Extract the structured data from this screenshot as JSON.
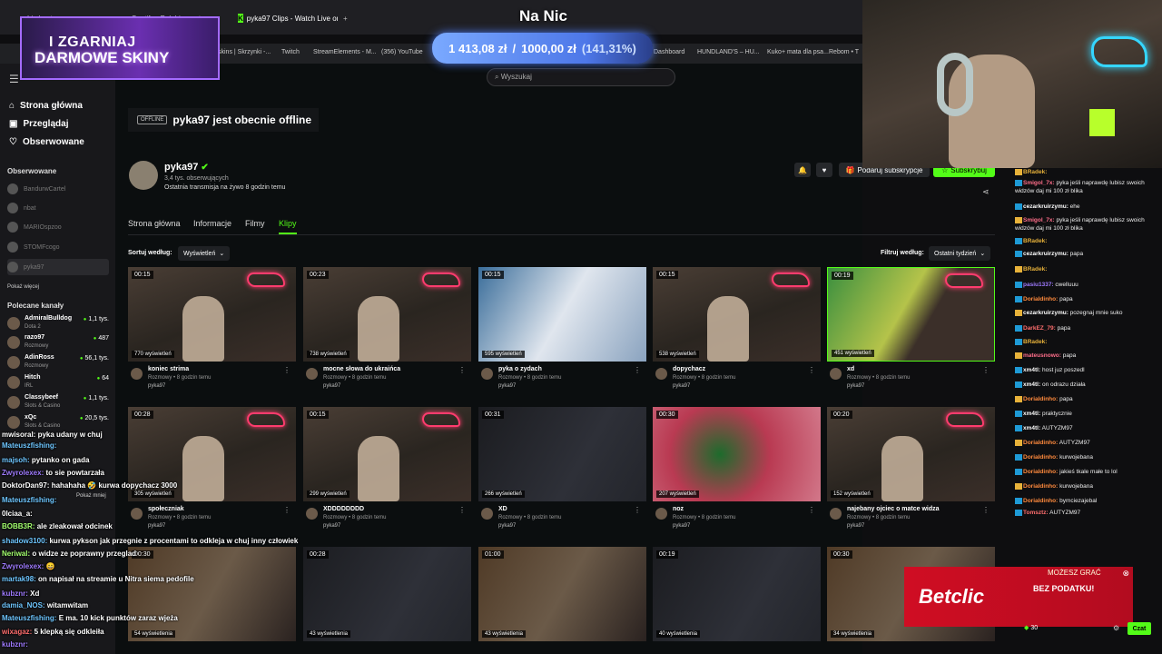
{
  "browser": {
    "tabs": [
      {
        "label": "Lis hosta"
      },
      {
        "label": "Spotify - Polubione utwory"
      },
      {
        "label": "pyka97 Clips - Watch Live on Kick"
      }
    ],
    "new_tab": "+",
    "bookmarks": [
      "skins | Skrzynki -...",
      "Twitch",
      "StreamElements - M...",
      "(356) YouTube",
      "Dashboard",
      "HUNDLAND'S – HU...",
      "Kuko+ mata dla psa...",
      "Rebom • T"
    ]
  },
  "overlay": {
    "promo_line1": "I ZGARNIAJ",
    "promo_line2": "DARMOWE SKINY",
    "title": "Na Nic",
    "goal_current": "1 413,08 zł",
    "goal_sep": "/",
    "goal_target": "1000,00 zł",
    "goal_pct": "(141,31%)"
  },
  "search": {
    "placeholder": "Wyszukaj"
  },
  "sidebar": {
    "nav": [
      {
        "label": "Strona główna",
        "icon": "home-icon"
      },
      {
        "label": "Przeglądaj",
        "icon": "browse-icon"
      },
      {
        "label": "Obserwowane",
        "icon": "heart-icon"
      }
    ],
    "followed_heading": "Obserwowane",
    "followed": [
      "BandurwCartel",
      "nbat",
      "MARIOspzoo",
      "STOMFcogo",
      "pyka97"
    ],
    "show_more": "Pokaż więcej",
    "recommended_heading": "Polecane kanały",
    "recommended": [
      {
        "name": "AdmiralBulldog",
        "game": "Dota 2",
        "viewers": "1,1 tys."
      },
      {
        "name": "razo97",
        "game": "Rozmowy",
        "viewers": "487"
      },
      {
        "name": "AdinRoss",
        "game": "Rozmowy",
        "viewers": "56,1 tys."
      },
      {
        "name": "Hitch",
        "game": "IRL",
        "viewers": "64"
      },
      {
        "name": "Classybeef",
        "game": "Slots & Casino",
        "viewers": "1,1 tys."
      },
      {
        "name": "xQc",
        "game": "Slots & Casino",
        "viewers": "20,5 tys."
      }
    ],
    "show_less": "Pokaż mniej"
  },
  "channel": {
    "offline_badge": "OFFLINE",
    "offline_text": "pyka97 jest obecnie offline",
    "name": "pyka97",
    "followers": "3,4 tys. obserwujących",
    "last_stream": "Ostatnia transmisja na żywo 8 godzin temu",
    "gift_sub": "Podaruj subskrypcje",
    "subscribe": "Subskrybuj",
    "tabs": [
      "Strona główna",
      "Informacje",
      "Filmy",
      "Klipy"
    ],
    "sort_label": "Sortuj według:",
    "sort_value": "Wyświetleń",
    "filter_label": "Filtruj według:",
    "filter_value": "Ostatni tydzień"
  },
  "clips": [
    {
      "duration": "00:15",
      "views": "770 wyświetleń",
      "title": "koniec strima",
      "meta": "Rozmowy • 8 godzin temu",
      "author": "pyka97"
    },
    {
      "duration": "00:23",
      "views": "738 wyświetleń",
      "title": "mocne słowa do ukraińca",
      "meta": "Rozmowy • 8 godzin temu",
      "author": "pyka97"
    },
    {
      "duration": "00:15",
      "views": "595 wyświetleń",
      "title": "pyka o zydach",
      "meta": "Rozmowy • 8 godzin temu",
      "author": "pyka97"
    },
    {
      "duration": "00:15",
      "views": "538 wyświetleń",
      "title": "dopychacz",
      "meta": "Rozmowy • 8 godzin temu",
      "author": "pyka97"
    },
    {
      "duration": "00:19",
      "views": "451 wyświetleń",
      "title": "xd",
      "meta": "Rozmowy • 8 godzin temu",
      "author": "pyka97"
    },
    {
      "duration": "00:28",
      "views": "305 wyświetleń",
      "title": "społeczniak",
      "meta": "Rozmowy • 8 godzin temu",
      "author": "pyka97"
    },
    {
      "duration": "00:15",
      "views": "299 wyświetleń",
      "title": "XDDDDDDDD",
      "meta": "Rozmowy • 8 godzin temu",
      "author": "pyka97"
    },
    {
      "duration": "00:31",
      "views": "266 wyświetleń",
      "title": "XD",
      "meta": "Rozmowy • 8 godzin temu",
      "author": "pyka97"
    },
    {
      "duration": "00:30",
      "views": "207 wyświetleń",
      "title": "noz",
      "meta": "Rozmowy • 8 godzin temu",
      "author": "pyka97"
    },
    {
      "duration": "00:20",
      "views": "152 wyświetleń",
      "title": "najebany ojciec o matce widza",
      "meta": "Rozmowy • 8 godzin temu",
      "author": "pyka97"
    },
    {
      "duration": "00:30",
      "views": "54 wyświetlenia"
    },
    {
      "duration": "00:28",
      "views": "43 wyświetlenia"
    },
    {
      "duration": "01:00",
      "views": "43 wyświetlenia"
    },
    {
      "duration": "00:19",
      "views": "40 wyświetlenia"
    },
    {
      "duration": "00:30",
      "views": "34 wyświetlenia"
    }
  ],
  "stream_chat_left": [
    {
      "user": "mwisoral:",
      "text": "pyka udany w chuj",
      "color": "#ffffff"
    },
    {
      "user": "Mateuszfishing:",
      "text": "",
      "color": "#6ec6ff"
    },
    {
      "user": "majsoh:",
      "text": "pytanko on gada",
      "color": "#6ec6ff"
    },
    {
      "user": "Zwyrolexex:",
      "text": "to sie powtarzała",
      "color": "#9f7bff"
    },
    {
      "user": "DoktorDan97:",
      "text": "hahahaha 🤣 kurwa dopychacz 3000",
      "color": "#ffffff"
    },
    {
      "user": "Mateuszfishing:",
      "text": "",
      "color": "#6ec6ff"
    },
    {
      "user": "0lciaa_a:",
      "text": "",
      "color": "#ffffff"
    },
    {
      "user": "BOBB3R:",
      "text": "ale zleakował odcinek",
      "color": "#a3ff6e"
    },
    {
      "user": "shadow3100:",
      "text": "kurwa pykson jak przegnie z procentami to odkleja w chuj inny człowiek",
      "color": "#6ec6ff"
    },
    {
      "user": "Neriwal:",
      "text": "o widze ze poprawny przeglad",
      "color": "#a3ff6e"
    },
    {
      "user": "Zwyrolexex:",
      "text": "😄",
      "color": "#9f7bff"
    },
    {
      "user": "martak98:",
      "text": "on napisał na streamie u Nitra siema pedofile",
      "color": "#6ec6ff"
    },
    {
      "user": "kubznr:",
      "text": "Xd",
      "color": "#9f7bff"
    },
    {
      "user": "damia_NOS:",
      "text": "witamwitam",
      "color": "#6ec6ff"
    },
    {
      "user": "Mateuszfishing:",
      "text": "E ma. 10 kick punktów zaraz wjeża",
      "color": "#6ec6ff"
    },
    {
      "user": "wixagaz:",
      "text": "5 klepką się odkleiła",
      "color": "#ff6e6e"
    },
    {
      "user": "kubznr:",
      "text": "",
      "color": "#9f7bff"
    }
  ],
  "kick_chat": [
    {
      "user": "BRadek:",
      "text": "",
      "color": "#e8b23a"
    },
    {
      "user": "Smigol_7x:",
      "text": "pyka jeśli naprawdę lubisz swoich widzów daj mi 100 zł blika",
      "color": "#ff6e8a"
    },
    {
      "user": "cezarkruirzymu:",
      "text": "ehe",
      "color": "#ffffff"
    },
    {
      "user": "Smigol_7x:",
      "text": "pyka jeśli naprawdę lubisz swoich widzów daj mi 100 zł blika",
      "color": "#ff6e8a"
    },
    {
      "user": "BRadek:",
      "text": "",
      "color": "#e8b23a"
    },
    {
      "user": "cezarkruirzymu:",
      "text": "papa",
      "color": "#ffffff"
    },
    {
      "user": "BRadek:",
      "text": "",
      "color": "#e8b23a"
    },
    {
      "user": "pasiu1337:",
      "text": "cwelluuu",
      "color": "#9f7bff"
    },
    {
      "user": "Dorialdinho:",
      "text": "papa",
      "color": "#ff8a3d"
    },
    {
      "user": "cezarkruirzymu:",
      "text": "pozegnaj mnie suko",
      "color": "#ffffff"
    },
    {
      "user": "DarkEZ_79:",
      "text": "papa",
      "color": "#ff6e6e"
    },
    {
      "user": "BRadek:",
      "text": "",
      "color": "#e8b23a"
    },
    {
      "user": "mateusnowo:",
      "text": "papa",
      "color": "#ff6e8a"
    },
    {
      "user": "xm4tl:",
      "text": "host juz poszedl",
      "color": "#ffffff"
    },
    {
      "user": "xm4tl:",
      "text": "on odrazu działa",
      "color": "#ffffff"
    },
    {
      "user": "Dorialdinho:",
      "text": "papa",
      "color": "#ff8a3d"
    },
    {
      "user": "xm4tl:",
      "text": "praktycznie",
      "color": "#ffffff"
    },
    {
      "user": "xm4tl:",
      "text": "AUTYZM97",
      "color": "#ffffff"
    },
    {
      "user": "Dorialdinho:",
      "text": "AUTYZM97",
      "color": "#ff8a3d"
    },
    {
      "user": "Dorialdinho:",
      "text": "kurwojebana",
      "color": "#ff8a3d"
    },
    {
      "user": "Dorialdinho:",
      "text": "jakieś tkale małe to lol",
      "color": "#ff8a3d"
    },
    {
      "user": "Dorialdinho:",
      "text": "kurwojebana",
      "color": "#ff8a3d"
    },
    {
      "user": "Dorialdinho:",
      "text": "bymciezajebal",
      "color": "#ff8a3d"
    },
    {
      "user": "Tomsztz:",
      "text": "AUTYZM97",
      "color": "#ff6e6e"
    }
  ],
  "ad": {
    "brand": "Betclic",
    "tagline": "BEZ PODATKU!",
    "top": "MOŻESZ GRAĆ",
    "points": "30"
  },
  "chat_send": "Czat",
  "colors": {
    "accent": "#53fc18",
    "bg": "#0e0e10",
    "betclic": "#d00d23"
  }
}
